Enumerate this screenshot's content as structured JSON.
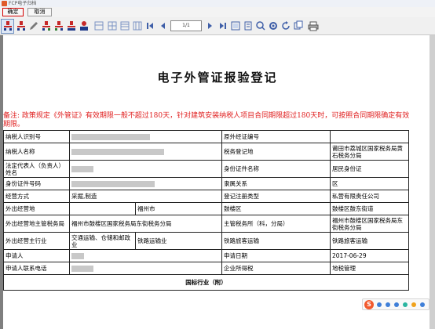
{
  "window": {
    "title": "FCP电子归档"
  },
  "buttons": {
    "confirm": "确定",
    "cancel": "取消"
  },
  "toolbar": {
    "icons": [
      "select-tool-icon",
      "print-design-icon",
      "edit-icon",
      "export-icon",
      "import-icon",
      "stamp-icon",
      "user-icon",
      "layout-icon",
      "grid-icon",
      "table-icon",
      "first-page-icon",
      "prev-page-icon",
      "next-page-icon",
      "last-page-icon",
      "zoom-fit-icon",
      "zoom-icon",
      "settings-icon",
      "refresh-icon",
      "print-icon"
    ],
    "page_indicator": "1/1"
  },
  "document": {
    "title": "电子外管证报验登记",
    "notice": "备注:  政策规定《外管证》有效期限一般不超过180天，针对建筑安装纳税人项目合同期限超过180天时，可按照合同期限确定有效期限。",
    "rows": [
      {
        "l1": "纳税人识别号",
        "v1": "",
        "l2": "原外经证编号",
        "v2": ""
      },
      {
        "l1": "纳税人名称",
        "v1": "",
        "l2": "税务登记地",
        "v2": "莆田市荔城区国家税务局黄石税务分局"
      },
      {
        "l1": "法定代表人（负责人）姓名",
        "v1": "",
        "l2": "身份证件名称",
        "v2": "居民身份证"
      },
      {
        "l1": "身份证件号码",
        "v1": "",
        "l2": "隶属关系",
        "v2": "区"
      },
      {
        "l1": "经营方式",
        "v1": "采掘,制造",
        "l2": "登记注册类型",
        "v2": "私营有限责任公司"
      }
    ],
    "row_outside_place": {
      "label": "外出经营地",
      "city": "福州市",
      "district": "鼓楼区",
      "street": "鼓楼区鼓东街道"
    },
    "row_tax_office": {
      "label": "外出经营地主管税务局",
      "value": "福州市鼓楼区国家税务局东街税务分局",
      "label2": "主管税务所（科，分局）",
      "value2": "福州市鼓楼区国家税务局东街税务分局"
    },
    "row_industry": {
      "label": "外出经营主行业",
      "value": "交通运输、仓储和邮政业",
      "value_b": "铁路运输业",
      "label2": "铁路旅客运输",
      "value2": "铁路旅客运输"
    },
    "row_applicant": {
      "label": "申请人",
      "label2": "申请日期",
      "value2": "2017-06-29"
    },
    "row_contact": {
      "label": "申请人联系电话",
      "label2": "企业所得税",
      "value2": "地税管理"
    },
    "section_header": "国标行业（附）"
  },
  "colors": {
    "notice_red": "#e02020",
    "confirm_border": "#d40000",
    "ime_orange": "#f25a2e"
  }
}
